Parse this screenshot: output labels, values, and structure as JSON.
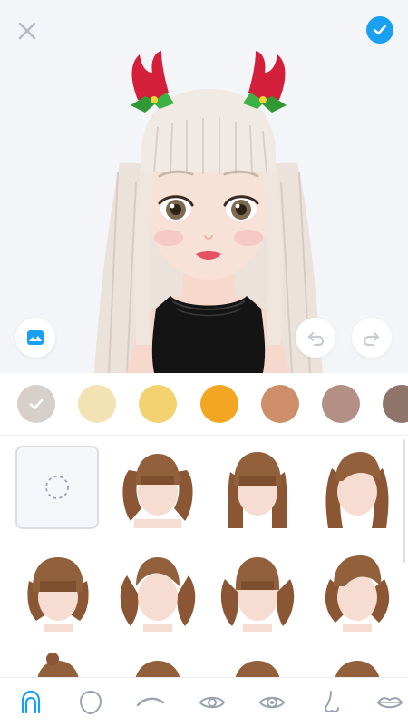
{
  "header": {
    "close_icon": "close-icon",
    "confirm_icon": "checkmark-circle-icon",
    "accent_color": "#1aa0f0"
  },
  "preview_controls": {
    "background_icon": "image-icon",
    "undo_icon": "undo-arrow-icon",
    "redo_icon": "redo-arrow-icon"
  },
  "hair_colors": {
    "selected_index": 0,
    "swatches": [
      "#d6cfca",
      "#f3e3b4",
      "#f3d070",
      "#f2a623",
      "#cd8e69",
      "#b48f84",
      "#8e7469"
    ]
  },
  "hair_styles": {
    "selected": "none",
    "items": [
      "none",
      "pigtails-bangs",
      "long-straight-bangs",
      "long-side-part",
      "bob-bangs",
      "twin-tails-curly",
      "twin-tails-bangs",
      "short-wavy-side"
    ]
  },
  "tabs": {
    "selected": "hair",
    "items": [
      "hair-icon",
      "face-shape-icon",
      "eyebrow-icon",
      "eye-icon",
      "eye-pupil-icon",
      "nose-icon",
      "lips-icon"
    ]
  }
}
